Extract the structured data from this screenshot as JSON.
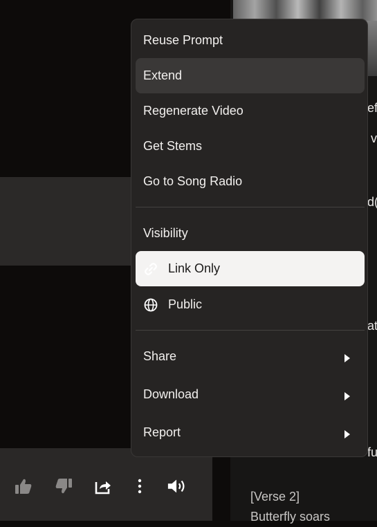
{
  "menu": {
    "items": [
      {
        "label": "Reuse Prompt"
      },
      {
        "label": "Extend"
      },
      {
        "label": "Regenerate Video"
      },
      {
        "label": "Get Stems"
      },
      {
        "label": "Go to Song Radio"
      }
    ],
    "visibility": {
      "heading": "Visibility",
      "options": [
        {
          "label": "Link Only",
          "icon": "link-icon",
          "selected": true
        },
        {
          "label": "Public",
          "icon": "globe-icon",
          "selected": false
        }
      ]
    },
    "submenus": [
      {
        "label": "Share"
      },
      {
        "label": "Download"
      },
      {
        "label": "Report"
      }
    ]
  },
  "background": {
    "peek_texts": [
      "ef",
      "v",
      "d(",
      "atl",
      "fu"
    ],
    "lyrics": [
      "[Verse 2]",
      "Butterfly soars"
    ]
  },
  "player_bar": {
    "icons": [
      "thumbs-up-icon",
      "thumbs-down-icon",
      "share-icon",
      "more-icon",
      "volume-icon"
    ]
  },
  "colors": {
    "menu_bg": "#262423",
    "hover_bg": "#3a3837",
    "selected_bg": "#f4f3f2",
    "page_bg": "#0d0b0a"
  }
}
